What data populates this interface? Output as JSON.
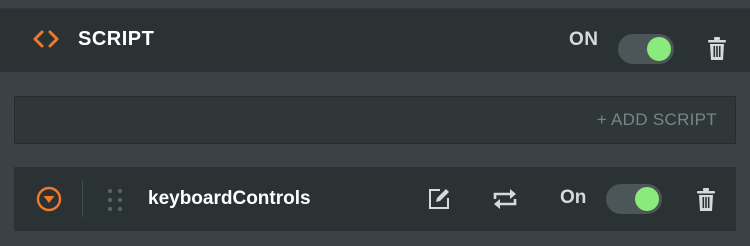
{
  "header": {
    "icon": "code-brackets-icon",
    "title": "SCRIPT",
    "toggle_label": "ON",
    "toggle_on": true,
    "delete_icon": "trash-icon"
  },
  "add_bar": {
    "button_label": "+ ADD SCRIPT"
  },
  "scripts": [
    {
      "name": "keyboardControls",
      "expand_icon": "chevron-down-circle-icon",
      "drag_icon": "drag-handle-icon",
      "edit_icon": "edit-icon",
      "loop_icon": "repeat-icon",
      "toggle_label": "On",
      "toggle_on": true,
      "delete_icon": "trash-icon"
    }
  ],
  "colors": {
    "accent": "#f07a2a",
    "toggle_on": "#8bea7c",
    "panel_bg": "#3a4245",
    "bar_bg": "#2b3234"
  }
}
